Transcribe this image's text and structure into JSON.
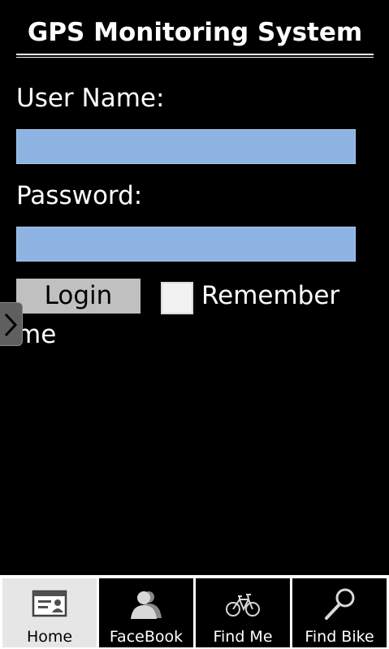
{
  "app": {
    "title": "GPS Monitoring System"
  },
  "login_form": {
    "username_label": "User Name:",
    "username_value": "",
    "password_label": "Password:",
    "password_value": "",
    "login_button_label": "Login",
    "remember_label_line1": "Remember",
    "remember_label_line2": "me",
    "remember_checked": false
  },
  "tabs": [
    {
      "label": "Home",
      "icon": "id-card-icon",
      "active": true
    },
    {
      "label": "FaceBook",
      "icon": "person-icon",
      "active": false
    },
    {
      "label": "Find Me",
      "icon": "bicycle-icon",
      "active": false
    },
    {
      "label": "Find Bike",
      "icon": "magnifier-icon",
      "active": false
    }
  ],
  "colors": {
    "background": "#000000",
    "input_fill": "#8db4e2",
    "button_fill": "#c0c0c0",
    "active_tab": "#e6e6e6"
  }
}
